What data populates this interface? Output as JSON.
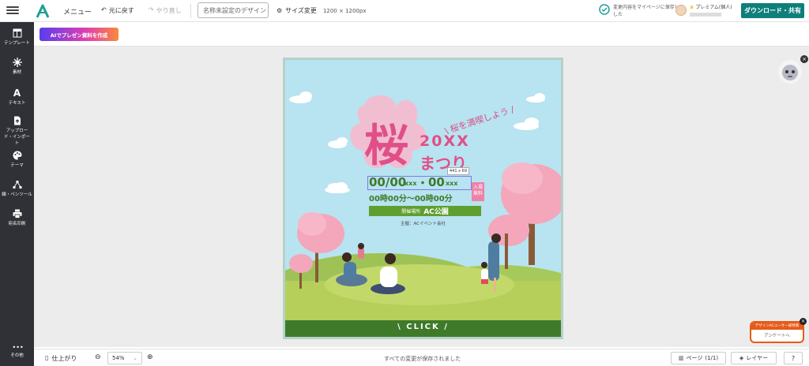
{
  "header": {
    "menu_label": "メニュー",
    "undo_label": "元に戻す",
    "redo_label": "やり直し",
    "title_placeholder": "名称未設定のデザイン",
    "size_label": "サイズ変更",
    "size_value": "1200 × 1200px",
    "saved_status": "変更内容をマイページに保存しました",
    "plan_label": "プレミアム(個人)",
    "download_label": "ダウンロード・共有"
  },
  "sidebar": {
    "items": [
      {
        "label": "テンプレート",
        "icon": "template-icon"
      },
      {
        "label": "素材",
        "icon": "material-icon"
      },
      {
        "label": "テキスト",
        "icon": "text-icon"
      },
      {
        "label": "アップロード・インポート",
        "icon": "upload-icon"
      },
      {
        "label": "テーマ",
        "icon": "palette-icon"
      },
      {
        "label": "線・ペンツール",
        "icon": "pen-icon"
      },
      {
        "label": "宛名印刷",
        "icon": "print-icon"
      },
      {
        "label": "その他",
        "icon": "more-icon"
      }
    ]
  },
  "toolbar": {
    "ai_button_label": "AIでプレゼン資料を作成"
  },
  "design": {
    "subtitle": "\\ 桜を満喫しよう /",
    "kanji": "桜",
    "year": "20XX",
    "matsuri": "まつり",
    "selection_size": "441 x 69",
    "date": "00/00",
    "date_dow1": "xxx",
    "date_dot": "・",
    "date2": "00",
    "date_dow2": "xxx",
    "time": "00時00分〜00時00分",
    "free_badge": "入場無料",
    "venue_label": "開催場所",
    "venue_name": "AC公園",
    "organizer": "主催：ACイベント会社",
    "click_label": "\\ CLICK /"
  },
  "bottom": {
    "finish_label": "仕上がり",
    "zoom_value": "54%",
    "save_status": "すべての変更が保存されました",
    "page_label": "ページ",
    "page_count": "(1/1)",
    "layer_label": "レイヤー",
    "help_label": "?"
  },
  "survey": {
    "header": "デザインACユーザー様特典",
    "body": "アンケートへ"
  },
  "colors": {
    "accent": "#0e7f7a",
    "sakura_pink": "#e8578f",
    "sky": "#b8e3f0",
    "grass": "#b6cf5a",
    "dark_green": "#3f7a2a"
  }
}
